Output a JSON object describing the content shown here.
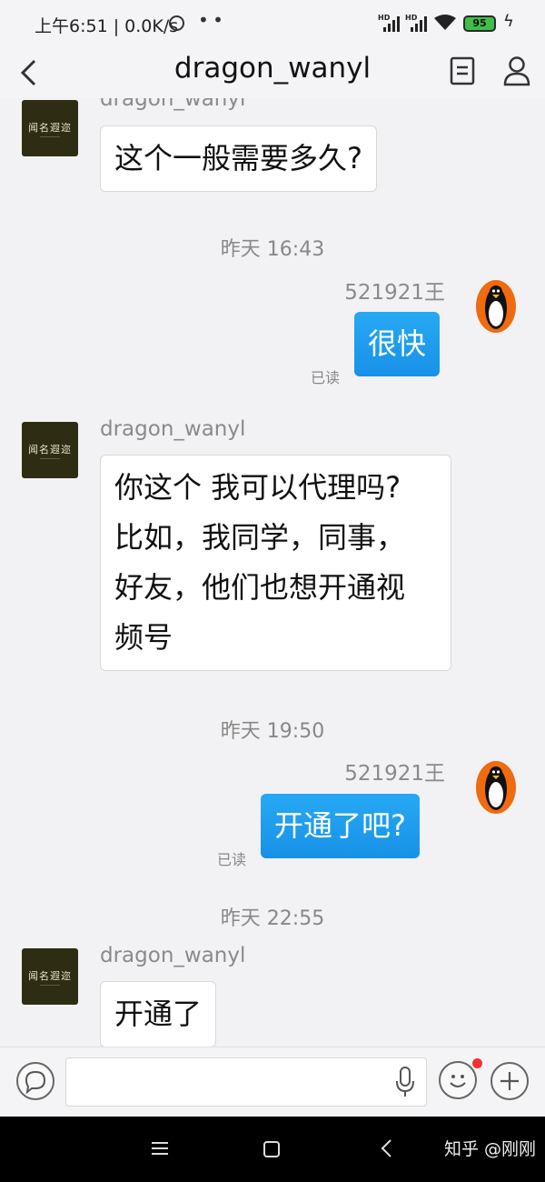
{
  "status_bar": {
    "time": "上午6:51",
    "net_speed": "0.0K/s",
    "battery": "95",
    "icons": [
      "alarm-icon",
      "signal-hd-icon",
      "signal-hd-icon",
      "wifi-icon",
      "battery-icon",
      "charging-icon"
    ]
  },
  "header": {
    "title": "dragon_wanyl",
    "icons": [
      "back-icon",
      "profile-card-icon",
      "person-icon"
    ]
  },
  "contact_avatar": {
    "logo_text": "闻名遐迩"
  },
  "messages": [
    {
      "type": "incoming",
      "sender": "dragon_wanyl",
      "text": "这个一般需要多久?"
    },
    {
      "type": "timestamp",
      "text": "昨天 16:43"
    },
    {
      "type": "outgoing",
      "sender": "521921王",
      "text": "很快",
      "status": "已读"
    },
    {
      "type": "incoming",
      "sender": "dragon_wanyl",
      "lines": [
        "你这个 我可以代理吗?",
        "比如，我同学，同事，",
        "好友，他们也想开通视",
        "频号"
      ]
    },
    {
      "type": "timestamp",
      "text": "昨天 19:50"
    },
    {
      "type": "outgoing",
      "sender": "521921王",
      "text": "开通了吧?",
      "status": "已读"
    },
    {
      "type": "timestamp",
      "text": "昨天 22:55"
    },
    {
      "type": "incoming",
      "sender": "dragon_wanyl",
      "text": "开通了"
    }
  ],
  "input_bar": {
    "placeholder": "",
    "icons": [
      "chat-bubble-icon",
      "mic-icon",
      "emoji-icon",
      "plus-icon"
    ]
  },
  "watermark": "知乎 @刚刚",
  "colors": {
    "outgoing_bubble": "#1e9bef",
    "background": "#f2f2f4",
    "avatar_bg": "#2e2c13",
    "penguin_orange": "#f06a10"
  }
}
